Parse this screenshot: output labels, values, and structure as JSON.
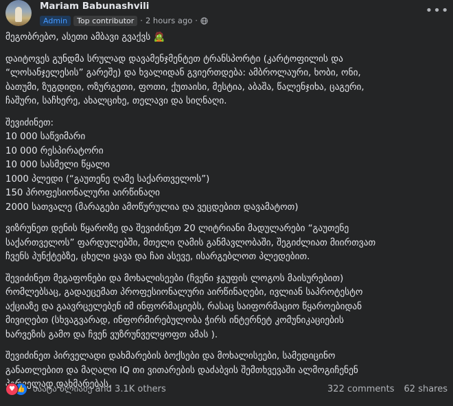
{
  "post": {
    "author": "Mariam Babunashvili",
    "badges": {
      "admin": "Admin",
      "top": "Top contributor"
    },
    "separator": "·",
    "time": "2 hours ago",
    "separator2": "·",
    "more_label": "•••",
    "intro": "მეგობრებო, ასეთი ამბავი გვაქვს 🧟",
    "paragraph1": [
      "დაიტოვეს გუნდმა სრულად დავამენჯმენტეთ ტრანსპორტი (კარტოფილის და",
      "“ლოსანჯელესის” გარეშე) და ხვალიდან გვიერთდება: ამბროლაური, ხობი, ონი,",
      "ბათუმი, ზუგდიდი, ოზურგეთი, ფოთი, ქუთაისი, მესტია, აბაშა, წალენჯიხა, ცაგერი,",
      "ჩაშური, საჩხერე, ახალციხე, თელავი და სიღნაღი."
    ],
    "list_title": "შევიძინეთ:",
    "list": [
      "10 000 საწვიმარი",
      "10 000 რესპირატორი",
      "10 000 სასმელი წყალი",
      "1000 პლედი (“გაუთენე ღამე საქართველოს”)",
      "150 პროფესიონალური აირწინაღი",
      "2000 სათვალე (მარაგები ამოწურულია და ვეცდებით დავამატოთ)"
    ],
    "paragraph2": [
      "ვიზრუნეთ დენის წყაროზე და შევიძინეთ 20 ლიტრიანი მადულარები “გაუთენე",
      "საქართველოს” ფარდულებში, მთელი ღამის განმავლობაში, შეგიძლიათ მიირთვათ",
      "ჩვენს პუნქტებზე, ცხელი ყავა და ჩაი ასევე, ისარგებლოთ პლედებით."
    ],
    "paragraph3": [
      "შევიძინეთ მეგაფონები და მოხალისეები (ჩვენი ჯგუფის ლოგოს მაისურებით)",
      "რომლებსაც, გადაეცემათ პროფესიონალური აირწინაღები, ივლიან საპროტესტო",
      "აქციაზე და გაავრცელებენ იმ ინფორმაციებს, რასაც საიფორმაციო წყაროებიდან",
      "მივიღებთ (სხვაგვარად, ინფორმირებულობა ჭირს ინტერნეტ კომუნიკაციების",
      "ხარვეზის გამო და ჩვენ ვუზრუნველყოფთ ამას )."
    ],
    "paragraph4": [
      "შევიძინეთ პირველადი დახმარების ბოქსები და მოხალისეები, სამედიცინო",
      "განათლებით და მაღალი IQ თი ვითარების დაძაბვის შემთხვევაში ალმოგიჩენენ",
      "პირველად დახმარებას."
    ],
    "reactions": {
      "love_icon": "heart-icon",
      "like_icon": "thumbs-up-icon",
      "love_glyph": "♥",
      "like_glyph": "👍",
      "text": "პაატა ბლიაძე and 3.1K others"
    },
    "comments": "322 comments",
    "shares": "62 shares",
    "colors": {
      "background": "#242526",
      "text": "#e4e6eb",
      "muted": "#b0b3b8",
      "admin": "#4599ff",
      "love": "#f33e58",
      "like": "#1877f2"
    }
  }
}
